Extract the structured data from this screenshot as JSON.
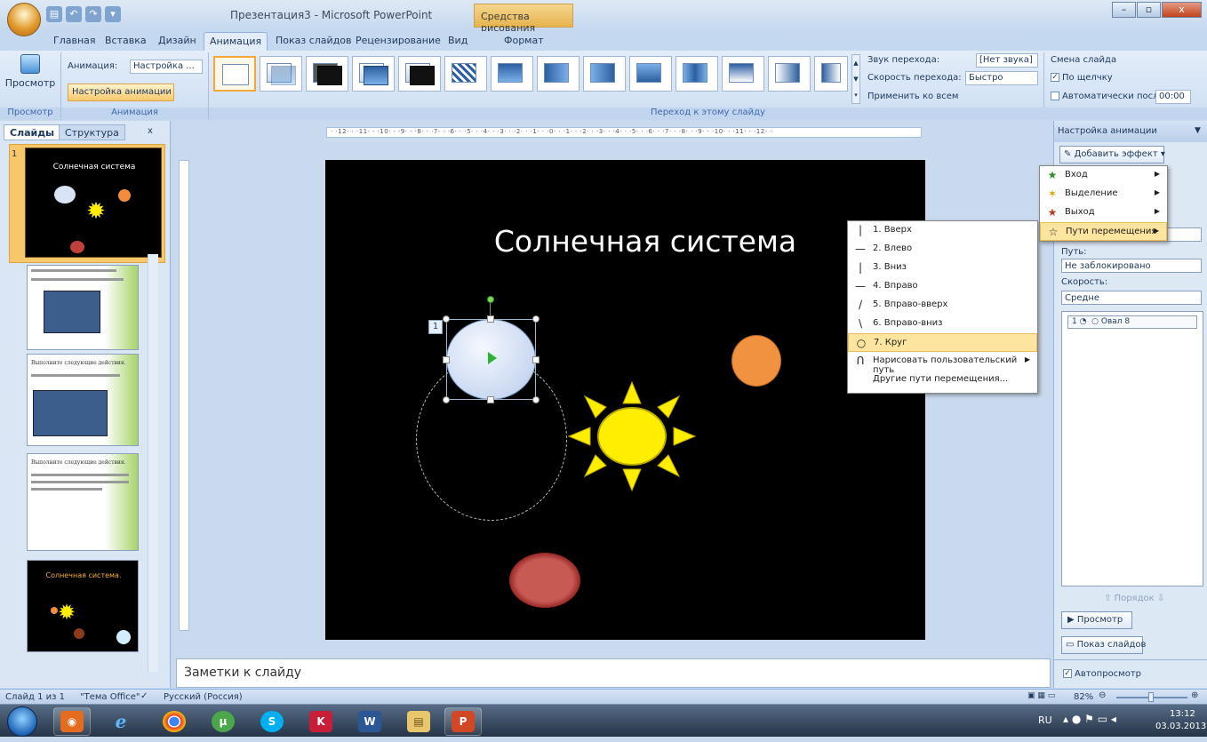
{
  "window": {
    "title": "Презентация3 - Microsoft PowerPoint",
    "context_tab": "Средства рисования",
    "minimize": "–",
    "maximize": "▫",
    "close": "x"
  },
  "ribbon_tabs": [
    "Главная",
    "Вставка",
    "Дизайн",
    "Анимация",
    "Показ слайдов",
    "Рецензирование",
    "Вид",
    "Формат"
  ],
  "ribbon": {
    "preview_label": "Просмотр",
    "animation_label": "Анимация:",
    "animation_value": "Настройка ...",
    "custom_animation_btn": "Настройка анимации",
    "group_preview": "Просмотр",
    "group_animation": "Анимация",
    "group_transition": "Переход к этому слайду",
    "sound_label": "Звук перехода:",
    "sound_value": "[Нет звука]",
    "speed_label": "Скорость перехода:",
    "speed_value": "Быстро",
    "apply_all": "Применить ко всем",
    "change_slide": "Смена слайда",
    "on_click": "По щелчку",
    "auto_after": "Автоматически после:",
    "auto_time": "00:00"
  },
  "left_panel": {
    "tab_slides": "Слайды",
    "tab_outline": "Структура",
    "close": "x",
    "slide1_title": "Солнечная система",
    "slide1_num": "1",
    "slide5_title": "Солнечная система.",
    "slide3_title": "Выполните следующие действия.",
    "slide4_title": "Выполните следующие действия."
  },
  "ruler": {
    "h": "· ·12· · ·11· · ·10· · ·9· · ·8· · ·7· · ·6· · ·5· · ·4· · ·3· · ·2· · ·1· · ·0· · ·1· · ·2· · ·3· · ·4· · ·5· · ·6· · ·7· · ·8· · ·9· · ·10· · ·11· · ·12· ·"
  },
  "slide": {
    "title": "Солнечная система",
    "anim_tag": "1"
  },
  "notes": {
    "text": "Заметки к слайду"
  },
  "motion_menu": [
    {
      "label": "1. Вверх",
      "icon": "|"
    },
    {
      "label": "2. Влево",
      "icon": "—"
    },
    {
      "label": "3. Вниз",
      "icon": "|"
    },
    {
      "label": "4. Вправо",
      "icon": "—"
    },
    {
      "label": "5. Вправо-вверх",
      "icon": "/"
    },
    {
      "label": "6. Вправо-вниз",
      "icon": "\\"
    },
    {
      "label": "7. Круг",
      "icon": "○"
    },
    {
      "label": "Нарисовать пользовательский путь",
      "icon": "ᑎ"
    },
    {
      "label": "Другие пути перемещения...",
      "icon": ""
    }
  ],
  "effect_menu": [
    {
      "label": "Вход",
      "icon": "★"
    },
    {
      "label": "Выделение",
      "icon": "✶"
    },
    {
      "label": "Выход",
      "icon": "★"
    },
    {
      "label": "Пути перемещения",
      "icon": "☆"
    }
  ],
  "right_pane": {
    "title": "Настройка анимации",
    "add_effect": "Добавить эффект",
    "path_label": "Путь:",
    "path_value": "Не заблокировано",
    "speed_label": "Скорость:",
    "speed_value": "Средне",
    "list_item_num": "1",
    "list_item": "Овал 8",
    "order_label": "Порядок",
    "preview_btn": "Просмотр",
    "slideshow_btn": "Показ слайдов",
    "autopreview": "Автопросмотр"
  },
  "status": {
    "slide_info": "Слайд 1 из 1",
    "theme": "\"Тема Office\"",
    "language": "Русский (Россия)",
    "zoom": "82%"
  },
  "taskbar": {
    "lang": "RU",
    "time": "13:12",
    "date": "03.03.2013"
  }
}
